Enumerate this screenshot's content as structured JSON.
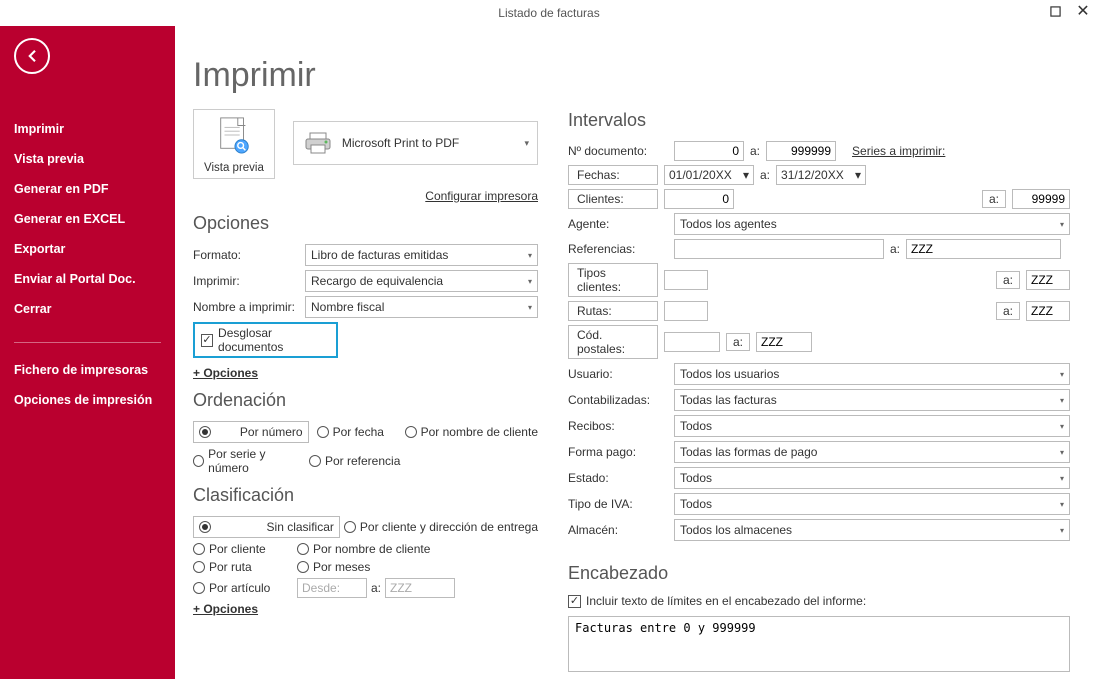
{
  "window": {
    "title": "Listado de facturas"
  },
  "sidebar": {
    "items": [
      "Imprimir",
      "Vista previa",
      "Generar en PDF",
      "Generar en EXCEL",
      "Exportar",
      "Enviar al Portal Doc.",
      "Cerrar"
    ],
    "secondary": [
      "Fichero de impresoras",
      "Opciones de impresión"
    ]
  },
  "page": {
    "title": "Imprimir",
    "preview_label": "Vista previa",
    "printer": "Microsoft Print to PDF",
    "config_printer": "Configurar impresora"
  },
  "opciones": {
    "heading": "Opciones",
    "formato_label": "Formato:",
    "formato_value": "Libro de facturas emitidas",
    "imprimir_label": "Imprimir:",
    "imprimir_value": "Recargo de equivalencia",
    "nombre_label": "Nombre a imprimir:",
    "nombre_value": "Nombre fiscal",
    "desglosar_label": "Desglosar documentos",
    "mas_opciones": "+ Opciones"
  },
  "ordenacion": {
    "heading": "Ordenación",
    "opts": [
      "Por número",
      "Por fecha",
      "Por nombre de cliente",
      "Por serie y número",
      "Por referencia"
    ]
  },
  "clasificacion": {
    "heading": "Clasificación",
    "col1": [
      "Sin clasificar",
      "Por cliente",
      "Por ruta",
      "Por artículo"
    ],
    "col2": [
      "Por cliente y dirección de entrega",
      "Por nombre de cliente",
      "Por meses"
    ],
    "desde_ph": "Desde:",
    "a_label": "a:",
    "zzz_ph": "ZZZ",
    "mas_opciones": "+ Opciones"
  },
  "intervalos": {
    "heading": "Intervalos",
    "ndoc_label": "Nº documento:",
    "ndoc_from": "0",
    "ndoc_a": "a:",
    "ndoc_to": "999999",
    "series_link": "Series a imprimir:",
    "fechas_label": "Fechas:",
    "fecha_from": "01/01/20XX",
    "fecha_a": "a:",
    "fecha_to": "31/12/20XX",
    "clientes_label": "Clientes:",
    "cli_from": "0",
    "cli_a": "a:",
    "cli_to": "99999",
    "agente_label": "Agente:",
    "agente_value": "Todos los agentes",
    "ref_label": "Referencias:",
    "ref_a": "a:",
    "ref_to": "ZZZ",
    "tipos_label": "Tipos clientes:",
    "tipos_a": "a:",
    "tipos_to": "ZZZ",
    "rutas_label": "Rutas:",
    "rutas_a": "a:",
    "rutas_to": "ZZZ",
    "cp_label": "Cód. postales:",
    "cp_a": "a:",
    "cp_to": "ZZZ",
    "usuario_label": "Usuario:",
    "usuario_value": "Todos los usuarios",
    "contab_label": "Contabilizadas:",
    "contab_value": "Todas las facturas",
    "recibos_label": "Recibos:",
    "recibos_value": "Todos",
    "fp_label": "Forma pago:",
    "fp_value": "Todas las formas de pago",
    "estado_label": "Estado:",
    "estado_value": "Todos",
    "iva_label": "Tipo de IVA:",
    "iva_value": "Todos",
    "alm_label": "Almacén:",
    "alm_value": "Todos los almacenes"
  },
  "encabezado": {
    "heading": "Encabezado",
    "incluir_label": "Incluir texto de límites en el encabezado del informe:",
    "text": "Facturas entre 0 y 999999"
  }
}
